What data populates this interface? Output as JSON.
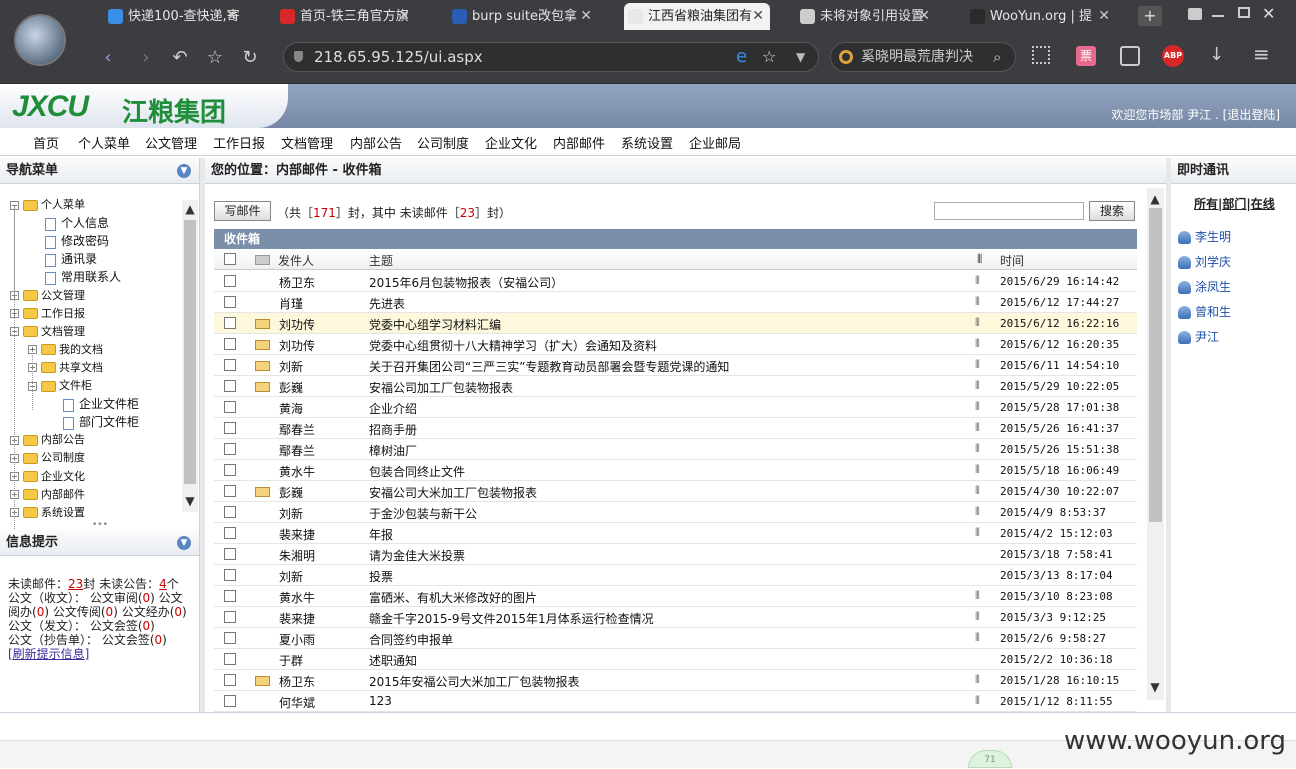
{
  "browser": {
    "tabs": [
      {
        "label": "快递100-查快递,寄",
        "active": false
      },
      {
        "label": "首页-铁三角官方旗",
        "active": false
      },
      {
        "label": "burp suite改包拿",
        "active": false
      },
      {
        "label": "江西省粮油集团有",
        "active": true
      },
      {
        "label": "未将对象引用设置",
        "active": false
      },
      {
        "label": "WooYun.org | 提",
        "active": false
      }
    ],
    "url": "218.65.95.125/ui.aspx",
    "search_placeholder": "奚晓明最荒唐判决",
    "new_tab": "+",
    "abp": "ABP"
  },
  "header": {
    "logo_en": "JXCU",
    "logo_cn": "江粮集团",
    "welcome": "欢迎您市场部 尹江 . [退出登陆]"
  },
  "nav": [
    "首页",
    "个人菜单",
    "公文管理",
    "工作日报",
    "文档管理",
    "内部公告",
    "公司制度",
    "企业文化",
    "内部邮件",
    "系统设置",
    "企业邮局"
  ],
  "sidebar": {
    "title": "导航菜单",
    "tree": [
      {
        "label": "个人菜单",
        "level": 0,
        "type": "folder",
        "pm": "−"
      },
      {
        "label": "个人信息",
        "level": 1,
        "type": "doc"
      },
      {
        "label": "修改密码",
        "level": 1,
        "type": "doc"
      },
      {
        "label": "通讯录",
        "level": 1,
        "type": "doc"
      },
      {
        "label": "常用联系人",
        "level": 1,
        "type": "doc"
      },
      {
        "label": "公文管理",
        "level": 0,
        "type": "folder",
        "pm": "+"
      },
      {
        "label": "工作日报",
        "level": 0,
        "type": "folder",
        "pm": "+"
      },
      {
        "label": "文档管理",
        "level": 0,
        "type": "folder",
        "pm": "−"
      },
      {
        "label": "我的文档",
        "level": 1,
        "type": "folder",
        "pm": "+"
      },
      {
        "label": "共享文档",
        "level": 1,
        "type": "folder",
        "pm": "+"
      },
      {
        "label": "文件柜",
        "level": 1,
        "type": "folder",
        "pm": "−"
      },
      {
        "label": "企业文件柜",
        "level": 2,
        "type": "doc"
      },
      {
        "label": "部门文件柜",
        "level": 2,
        "type": "doc"
      },
      {
        "label": "内部公告",
        "level": 0,
        "type": "folder",
        "pm": "+"
      },
      {
        "label": "公司制度",
        "level": 0,
        "type": "folder",
        "pm": "+"
      },
      {
        "label": "企业文化",
        "level": 0,
        "type": "folder",
        "pm": "+"
      },
      {
        "label": "内部邮件",
        "level": 0,
        "type": "folder",
        "pm": "+"
      },
      {
        "label": "系统设置",
        "level": 0,
        "type": "folder",
        "pm": "+"
      }
    ]
  },
  "info": {
    "title": "信息提示",
    "unread_mail_label": "未读邮件：",
    "unread_mail": "23",
    "unread_mail_unit": "封 未读公告：",
    "unread_notice": "4",
    "unread_notice_unit": "个",
    "line2a": "公文（收文）： 公文审阅",
    "v1": "0",
    "line2b": " 公文",
    "line3a": "阅办",
    "v2": "0",
    "line3b": " 公文传阅",
    "v3": "0",
    "line3c": " 公文经办",
    "v4": "0",
    "line4a": "公文（发文）： 公文会签",
    "v5": "0",
    "line5a": "公文（抄告单）： 公文会签",
    "v6": "0",
    "refresh": "[刷新提示信息]"
  },
  "main": {
    "breadcrumb": "您的位置：内部邮件 - 收件箱",
    "write_button": "写邮件",
    "summary_prefix": "（共［",
    "total": "171",
    "summary_mid": "］封，其中 未读邮件［",
    "unread": "23",
    "summary_suffix": "］封）",
    "search_button": "搜索",
    "inbox_title": "收件箱",
    "columns": {
      "sender": "发件人",
      "subject": "主题",
      "time": "时间"
    },
    "rows": [
      {
        "sender": "杨卫东",
        "subject": "2015年6月包装物报表（安福公司）",
        "time": "2015/6/29 16:14:42",
        "unread": false,
        "clip": true,
        "hl": false
      },
      {
        "sender": "肖瑾",
        "subject": "先进表",
        "time": "2015/6/12 17:44:27",
        "unread": false,
        "clip": true,
        "hl": false
      },
      {
        "sender": "刘功传",
        "subject": "党委中心组学习材料汇编",
        "time": "2015/6/12 16:22:16",
        "unread": true,
        "clip": true,
        "hl": true
      },
      {
        "sender": "刘功传",
        "subject": "党委中心组贯彻十八大精神学习（扩大）会通知及资料",
        "time": "2015/6/12 16:20:35",
        "unread": true,
        "clip": true,
        "hl": false
      },
      {
        "sender": "刘新",
        "subject": "关于召开集团公司“三严三实”专题教育动员部署会暨专题党课的通知",
        "time": "2015/6/11 14:54:10",
        "unread": true,
        "clip": true,
        "hl": false
      },
      {
        "sender": "彭巍",
        "subject": "安福公司加工厂包装物报表",
        "time": "2015/5/29 10:22:05",
        "unread": true,
        "clip": true,
        "hl": false
      },
      {
        "sender": "黄海",
        "subject": "企业介绍",
        "time": "2015/5/28 17:01:38",
        "unread": false,
        "clip": true,
        "hl": false
      },
      {
        "sender": "鄢春兰",
        "subject": "招商手册",
        "time": "2015/5/26 16:41:37",
        "unread": false,
        "clip": true,
        "hl": false
      },
      {
        "sender": "鄢春兰",
        "subject": "樟树油厂",
        "time": "2015/5/26 15:51:38",
        "unread": false,
        "clip": true,
        "hl": false
      },
      {
        "sender": "黄水牛",
        "subject": "包装合同终止文件",
        "time": "2015/5/18 16:06:49",
        "unread": false,
        "clip": true,
        "hl": false
      },
      {
        "sender": "彭巍",
        "subject": "安福公司大米加工厂包装物报表",
        "time": "2015/4/30 10:22:07",
        "unread": true,
        "clip": true,
        "hl": false
      },
      {
        "sender": "刘新",
        "subject": "于金沙包装与新干公",
        "time": "2015/4/9 8:53:37",
        "unread": false,
        "clip": true,
        "hl": false
      },
      {
        "sender": "裴来捷",
        "subject": "年报",
        "time": "2015/4/2 15:12:03",
        "unread": false,
        "clip": true,
        "hl": false
      },
      {
        "sender": "朱湘明",
        "subject": "请为金佳大米投票",
        "time": "2015/3/18 7:58:41",
        "unread": false,
        "clip": false,
        "hl": false
      },
      {
        "sender": "刘新",
        "subject": "投票",
        "time": "2015/3/13 8:17:04",
        "unread": false,
        "clip": false,
        "hl": false
      },
      {
        "sender": "黄水牛",
        "subject": "富硒米、有机大米修改好的图片",
        "time": "2015/3/10 8:23:08",
        "unread": false,
        "clip": true,
        "hl": false
      },
      {
        "sender": "裴来捷",
        "subject": "赣金千字2015-9号文件2015年1月体系运行检查情况",
        "time": "2015/3/3 9:12:25",
        "unread": false,
        "clip": true,
        "hl": false
      },
      {
        "sender": "夏小雨",
        "subject": "合同签约申报单",
        "time": "2015/2/6 9:58:27",
        "unread": false,
        "clip": true,
        "hl": false
      },
      {
        "sender": "于群",
        "subject": "述职通知",
        "time": "2015/2/2 10:36:18",
        "unread": false,
        "clip": false,
        "hl": false
      },
      {
        "sender": "杨卫东",
        "subject": "2015年安福公司大米加工厂包装物报表",
        "time": "2015/1/28 16:10:15",
        "unread": true,
        "clip": true,
        "hl": false
      },
      {
        "sender": "何华斌",
        "subject": "123",
        "time": "2015/1/12 8:11:55",
        "unread": false,
        "clip": true,
        "hl": false
      }
    ]
  },
  "right": {
    "title": "即时通讯",
    "filter": "所有|部门|在线",
    "contacts": [
      "李生明",
      "刘学庆",
      "涂凤生",
      "曾和生",
      "尹江"
    ]
  },
  "watermark": "www.wooyun.org",
  "badge": "71"
}
